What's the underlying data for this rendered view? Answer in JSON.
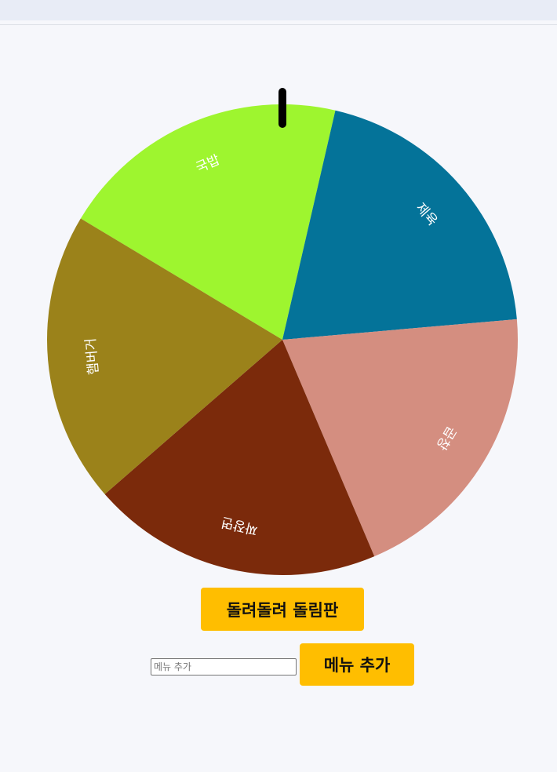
{
  "wheel": {
    "pointer_color": "#000000",
    "label_color": "#ffffff",
    "segments": [
      {
        "label": "국밥",
        "color": "#9ef52f"
      },
      {
        "label": "제육",
        "color": "#047399"
      },
      {
        "label": "곱창",
        "color": "#d48e80"
      },
      {
        "label": "짜장면",
        "color": "#7b2a0b"
      },
      {
        "label": "햄버거",
        "color": "#9b821a"
      }
    ]
  },
  "controls": {
    "spin_label": "돌려돌려 돌림판",
    "add_input_placeholder": "메뉴 추가",
    "add_input_value": "",
    "add_label": "메뉴 추가",
    "accent_color": "#ffbe00"
  }
}
